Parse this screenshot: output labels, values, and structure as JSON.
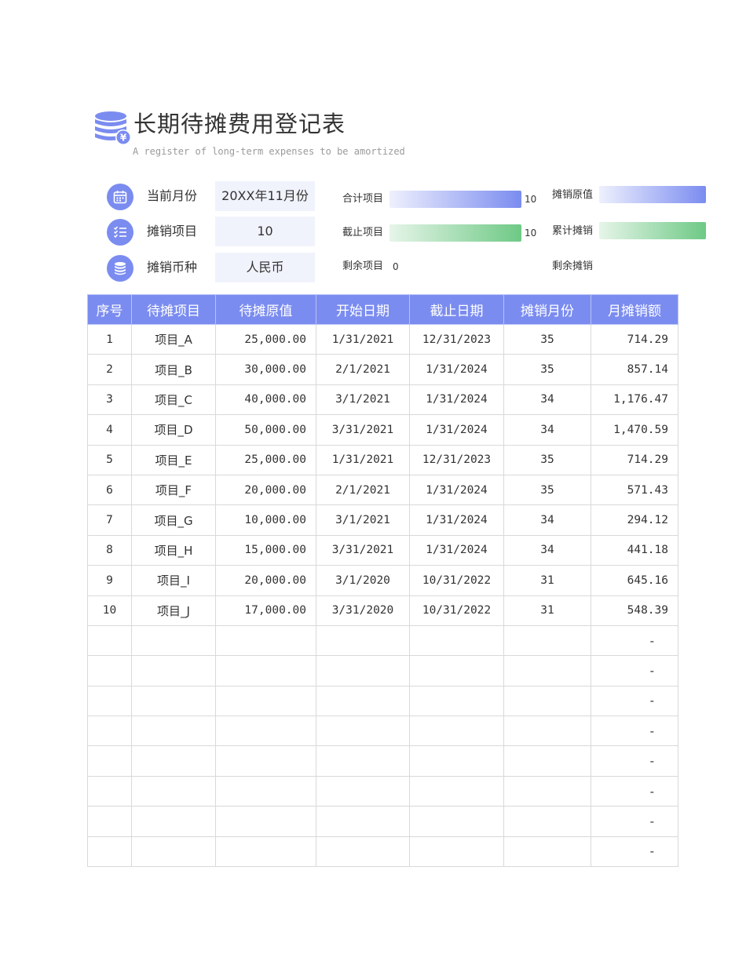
{
  "header": {
    "title": "长期待摊费用登记表",
    "subtitle": "A register of long-term expenses to be amortized",
    "logo_icon": "coin-stack-yen-icon"
  },
  "info": [
    {
      "label": "当前月份",
      "value": "20XX年11月份",
      "icon": "calendar-icon"
    },
    {
      "label": "摊销项目",
      "value": "10",
      "icon": "checklist-icon"
    },
    {
      "label": "摊销币种",
      "value": "人民币",
      "icon": "coin-stack-icon"
    }
  ],
  "stats": {
    "total_items": {
      "label": "合计项目",
      "value": "10",
      "fill": 1.0
    },
    "ended_items": {
      "label": "截止项目",
      "value": "10",
      "fill": 1.0
    },
    "remaining_items": {
      "label": "剩余项目",
      "value": "0",
      "fill": 0
    },
    "original_value": {
      "label": "摊销原值",
      "fill": 1.0
    },
    "accumulated": {
      "label": "累计摊销",
      "fill": 1.0
    },
    "remaining_amort": {
      "label": "剩余摊销"
    }
  },
  "colors": {
    "accent": "#7b8cf0",
    "green": "#6ec985",
    "value_bg": "#f1f3fc"
  },
  "table": {
    "headers": [
      "序号",
      "待摊项目",
      "待摊原值",
      "开始日期",
      "截止日期",
      "摊销月份",
      "月摊销额"
    ],
    "rows": [
      [
        "1",
        "项目_A",
        "25,000.00",
        "1/31/2021",
        "12/31/2023",
        "35",
        "714.29"
      ],
      [
        "2",
        "项目_B",
        "30,000.00",
        "2/1/2021",
        "1/31/2024",
        "35",
        "857.14"
      ],
      [
        "3",
        "项目_C",
        "40,000.00",
        "3/1/2021",
        "1/31/2024",
        "34",
        "1,176.47"
      ],
      [
        "4",
        "项目_D",
        "50,000.00",
        "3/31/2021",
        "1/31/2024",
        "34",
        "1,470.59"
      ],
      [
        "5",
        "项目_E",
        "25,000.00",
        "1/31/2021",
        "12/31/2023",
        "35",
        "714.29"
      ],
      [
        "6",
        "项目_F",
        "20,000.00",
        "2/1/2021",
        "1/31/2024",
        "35",
        "571.43"
      ],
      [
        "7",
        "项目_G",
        "10,000.00",
        "3/1/2021",
        "1/31/2024",
        "34",
        "294.12"
      ],
      [
        "8",
        "项目_H",
        "15,000.00",
        "3/31/2021",
        "1/31/2024",
        "34",
        "441.18"
      ],
      [
        "9",
        "项目_I",
        "20,000.00",
        "3/1/2020",
        "10/31/2022",
        "31",
        "645.16"
      ],
      [
        "10",
        "项目_J",
        "17,000.00",
        "3/31/2020",
        "10/31/2022",
        "31",
        "548.39"
      ],
      [
        "",
        "",
        "",
        "",
        "",
        "",
        "-"
      ],
      [
        "",
        "",
        "",
        "",
        "",
        "",
        "-"
      ],
      [
        "",
        "",
        "",
        "",
        "",
        "",
        "-"
      ],
      [
        "",
        "",
        "",
        "",
        "",
        "",
        "-"
      ],
      [
        "",
        "",
        "",
        "",
        "",
        "",
        "-"
      ],
      [
        "",
        "",
        "",
        "",
        "",
        "",
        "-"
      ],
      [
        "",
        "",
        "",
        "",
        "",
        "",
        "-"
      ],
      [
        "",
        "",
        "",
        "",
        "",
        "",
        "-"
      ]
    ]
  }
}
